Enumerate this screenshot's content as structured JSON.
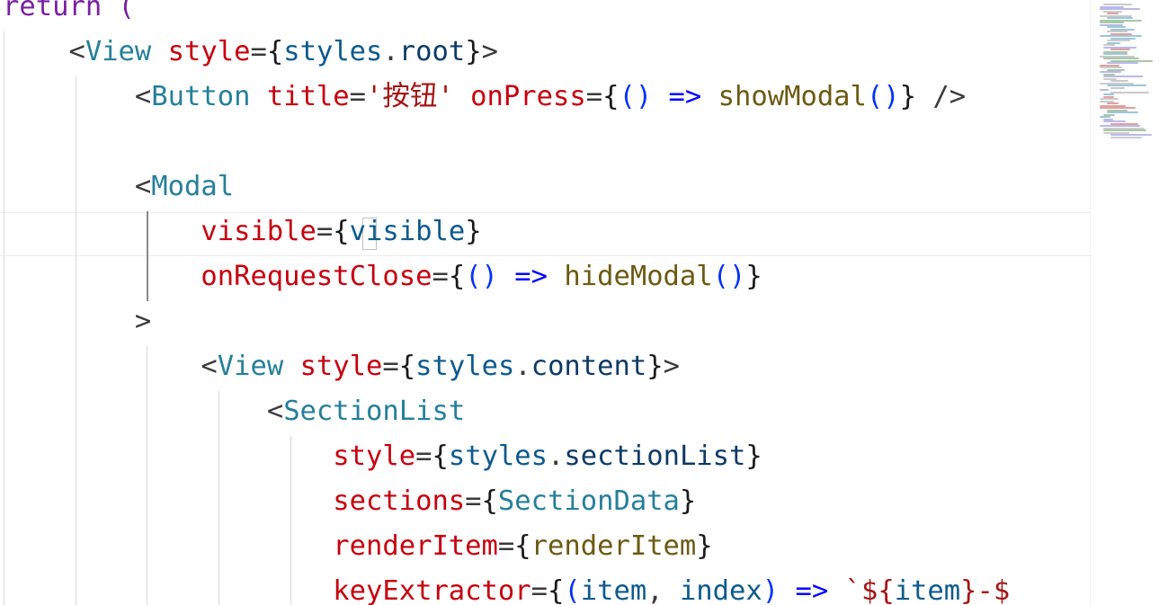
{
  "editor": {
    "lines": [
      [
        {
          "t": "return (",
          "c": "kw"
        }
      ],
      [
        {
          "t": "    ",
          "c": "plain"
        },
        {
          "t": "<",
          "c": "punct"
        },
        {
          "t": "View",
          "c": "tag"
        },
        {
          "t": " ",
          "c": "plain"
        },
        {
          "t": "style",
          "c": "attr"
        },
        {
          "t": "=",
          "c": "punct"
        },
        {
          "t": "{",
          "c": "brace"
        },
        {
          "t": "styles",
          "c": "var"
        },
        {
          "t": ".",
          "c": "punct"
        },
        {
          "t": "root",
          "c": "prop"
        },
        {
          "t": "}",
          "c": "brace"
        },
        {
          "t": ">",
          "c": "punct"
        }
      ],
      [
        {
          "t": "        ",
          "c": "plain"
        },
        {
          "t": "<",
          "c": "punct"
        },
        {
          "t": "Button",
          "c": "tag"
        },
        {
          "t": " ",
          "c": "plain"
        },
        {
          "t": "title",
          "c": "attr"
        },
        {
          "t": "=",
          "c": "punct"
        },
        {
          "t": "'按钮'",
          "c": "str"
        },
        {
          "t": " ",
          "c": "plain"
        },
        {
          "t": "onPress",
          "c": "attr"
        },
        {
          "t": "=",
          "c": "punct"
        },
        {
          "t": "{",
          "c": "brace"
        },
        {
          "t": "()",
          "c": "paren"
        },
        {
          "t": " => ",
          "c": "arrow"
        },
        {
          "t": "showModal",
          "c": "fn"
        },
        {
          "t": "()",
          "c": "paren"
        },
        {
          "t": "}",
          "c": "brace"
        },
        {
          "t": " />",
          "c": "punct"
        }
      ],
      [],
      [
        {
          "t": "        ",
          "c": "plain"
        },
        {
          "t": "<",
          "c": "punct"
        },
        {
          "t": "Modal",
          "c": "tag"
        }
      ],
      [
        {
          "t": "            ",
          "c": "plain"
        },
        {
          "t": "visible",
          "c": "attr"
        },
        {
          "t": "=",
          "c": "punct"
        },
        {
          "t": "{",
          "c": "brace"
        },
        {
          "t": "visible",
          "c": "var"
        },
        {
          "t": "}",
          "c": "brace"
        }
      ],
      [
        {
          "t": "            ",
          "c": "plain"
        },
        {
          "t": "onRequestClose",
          "c": "attr"
        },
        {
          "t": "=",
          "c": "punct"
        },
        {
          "t": "{",
          "c": "brace"
        },
        {
          "t": "()",
          "c": "paren"
        },
        {
          "t": " => ",
          "c": "arrow"
        },
        {
          "t": "hideModal",
          "c": "fn"
        },
        {
          "t": "()",
          "c": "paren"
        },
        {
          "t": "}",
          "c": "brace"
        }
      ],
      [
        {
          "t": "        ",
          "c": "plain"
        },
        {
          "t": ">",
          "c": "punct"
        }
      ],
      [
        {
          "t": "            ",
          "c": "plain"
        },
        {
          "t": "<",
          "c": "punct"
        },
        {
          "t": "View",
          "c": "tag"
        },
        {
          "t": " ",
          "c": "plain"
        },
        {
          "t": "style",
          "c": "attr"
        },
        {
          "t": "=",
          "c": "punct"
        },
        {
          "t": "{",
          "c": "brace"
        },
        {
          "t": "styles",
          "c": "var"
        },
        {
          "t": ".",
          "c": "punct"
        },
        {
          "t": "content",
          "c": "prop"
        },
        {
          "t": "}",
          "c": "brace"
        },
        {
          "t": ">",
          "c": "punct"
        }
      ],
      [
        {
          "t": "                ",
          "c": "plain"
        },
        {
          "t": "<",
          "c": "punct"
        },
        {
          "t": "SectionList",
          "c": "tag"
        }
      ],
      [
        {
          "t": "                    ",
          "c": "plain"
        },
        {
          "t": "style",
          "c": "attr"
        },
        {
          "t": "=",
          "c": "punct"
        },
        {
          "t": "{",
          "c": "brace"
        },
        {
          "t": "styles",
          "c": "var"
        },
        {
          "t": ".",
          "c": "punct"
        },
        {
          "t": "sectionList",
          "c": "prop"
        },
        {
          "t": "}",
          "c": "brace"
        }
      ],
      [
        {
          "t": "                    ",
          "c": "plain"
        },
        {
          "t": "sections",
          "c": "attr"
        },
        {
          "t": "=",
          "c": "punct"
        },
        {
          "t": "{",
          "c": "brace"
        },
        {
          "t": "SectionData",
          "c": "type"
        },
        {
          "t": "}",
          "c": "brace"
        }
      ],
      [
        {
          "t": "                    ",
          "c": "plain"
        },
        {
          "t": "renderItem",
          "c": "attr"
        },
        {
          "t": "=",
          "c": "punct"
        },
        {
          "t": "{",
          "c": "brace"
        },
        {
          "t": "renderItem",
          "c": "fn"
        },
        {
          "t": "}",
          "c": "brace"
        }
      ],
      [
        {
          "t": "                    ",
          "c": "plain"
        },
        {
          "t": "keyExtractor",
          "c": "attr"
        },
        {
          "t": "=",
          "c": "punct"
        },
        {
          "t": "{",
          "c": "brace"
        },
        {
          "t": "(",
          "c": "paren"
        },
        {
          "t": "item",
          "c": "var"
        },
        {
          "t": ", ",
          "c": "punct"
        },
        {
          "t": "index",
          "c": "var"
        },
        {
          "t": ")",
          "c": "paren"
        },
        {
          "t": " => ",
          "c": "arrow"
        },
        {
          "t": "`${",
          "c": "tmpl"
        },
        {
          "t": "item",
          "c": "var"
        },
        {
          "t": "}-$",
          "c": "tmpl"
        }
      ]
    ]
  },
  "colors": {
    "kw": "#7a1fa2",
    "tag": "#267f99",
    "attr": "#c4000f",
    "punct": "#3a3a3a",
    "brace": "#1a1a1a",
    "var": "#0d5a8c",
    "prop": "#0d3a66",
    "str": "#a31515",
    "paren": "#0431fa",
    "arrow": "#0000ff",
    "fn": "#6b5a12",
    "type": "#267f99",
    "tmpl": "#a31515",
    "plain": "#1f1f1f"
  }
}
